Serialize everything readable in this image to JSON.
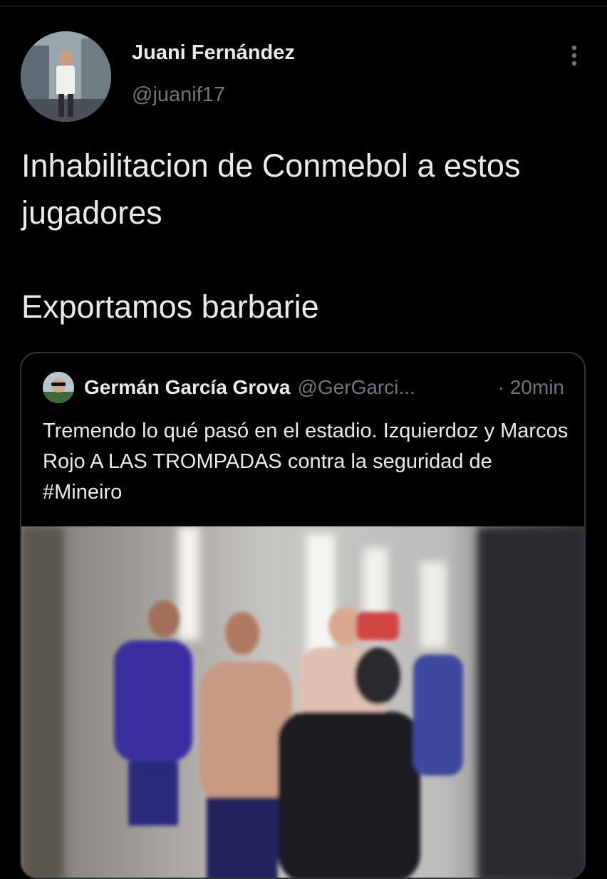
{
  "tweet": {
    "author_name": "Juani Fernández",
    "author_handle": "@juanif17",
    "text": "Inhabilitacion de Conmebol a estos jugadores\n\nExportamos barbarie",
    "more_icon": "more-vertical-icon"
  },
  "quoted_tweet": {
    "author_name": "Germán García Grova",
    "author_handle": "@GerGarci...",
    "time": "· 20min",
    "text": "Tremendo lo qué pasó en el estadio. Izquierdoz y Marcos Rojo A LAS TROMPADAS contra la seguridad de #Mineiro"
  },
  "colors": {
    "background": "#000000",
    "text_primary": "#e7e9ea",
    "text_secondary": "#71767b",
    "border": "#2f3336"
  }
}
